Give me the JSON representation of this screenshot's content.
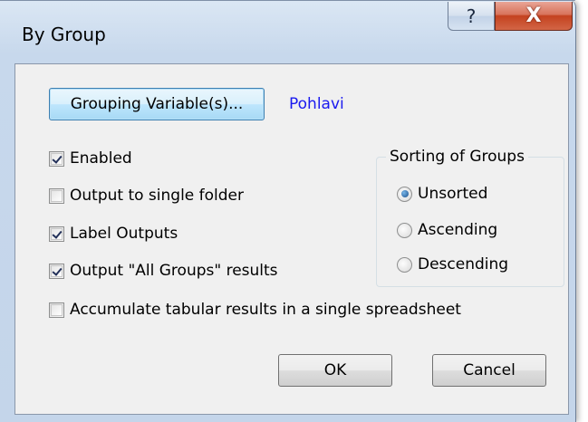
{
  "window": {
    "title": "By Group",
    "help_label": "?",
    "close_label": "X"
  },
  "grouping": {
    "button_label": "Grouping Variable(s)...",
    "selected_variable": "Pohlavi"
  },
  "options": [
    {
      "label": "Enabled",
      "checked": true
    },
    {
      "label": "Output to single folder",
      "checked": false
    },
    {
      "label": "Label Outputs",
      "checked": true
    },
    {
      "label": "Output \"All Groups\" results",
      "checked": true
    },
    {
      "label": "Accumulate tabular results in a single spreadsheet",
      "checked": false
    }
  ],
  "sorting": {
    "legend": "Sorting of Groups",
    "options": [
      {
        "label": "Unsorted",
        "selected": true
      },
      {
        "label": "Ascending",
        "selected": false
      },
      {
        "label": "Descending",
        "selected": false
      }
    ]
  },
  "footer": {
    "ok_label": "OK",
    "cancel_label": "Cancel"
  }
}
